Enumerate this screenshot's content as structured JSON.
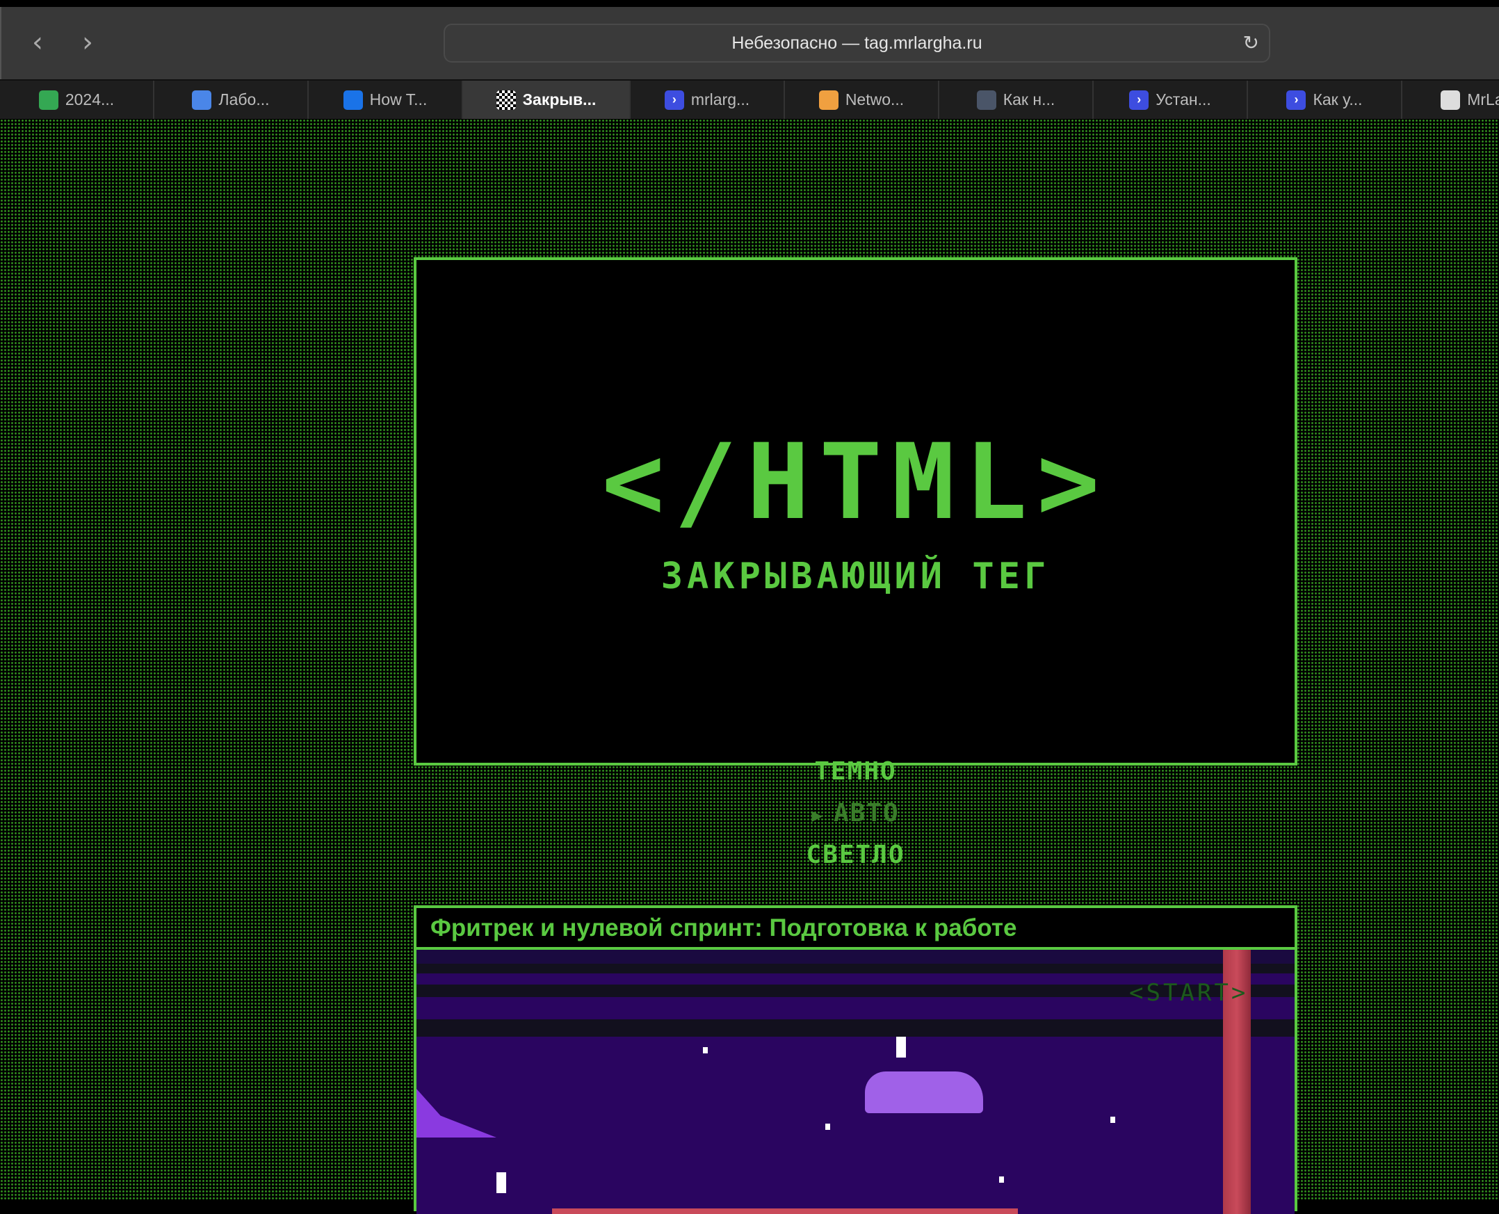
{
  "browser": {
    "url_text": "Небезопасно — tag.mrlargha.ru",
    "back": "‹",
    "forward": "›",
    "reload": "↻"
  },
  "tabs": [
    {
      "label": "2024...",
      "icon": "google-drive-icon",
      "color": "#34a853"
    },
    {
      "label": "Лабо...",
      "icon": "google-docs-icon",
      "color": "#4a86e8"
    },
    {
      "label": "How T...",
      "icon": "digitalocean-icon",
      "color": "#1a73e8"
    },
    {
      "label": "Закрыв...",
      "icon": "checker-icon",
      "color": "#ffffff"
    },
    {
      "label": "mrlarg...",
      "icon": "chevron-icon",
      "color": "#3d4de0"
    },
    {
      "label": "Netwo...",
      "icon": "x-icon",
      "color": "#f0a040"
    },
    {
      "label": "Как н...",
      "icon": "star-icon",
      "color": "#4a5568"
    },
    {
      "label": "Устан...",
      "icon": "chevron-icon",
      "color": "#3d4de0"
    },
    {
      "label": "Как у...",
      "icon": "chevron-icon",
      "color": "#3d4de0"
    },
    {
      "label": "MrLa...",
      "icon": "github-icon",
      "color": "#dddddd"
    }
  ],
  "hero": {
    "logo": "</HTML>",
    "subtitle": "ЗАКРЫВАЮЩИЙ ТЕГ",
    "menu": [
      "ТЕМНО",
      "АВТО",
      "СВЕТЛО"
    ],
    "selected_marker": "▶"
  },
  "post": {
    "title": "Фритрек и нулевой спринт: Подготовка к работе",
    "game_label": "<START>"
  },
  "colors": {
    "accent": "#5ac941",
    "dim": "#3a7d2a"
  }
}
